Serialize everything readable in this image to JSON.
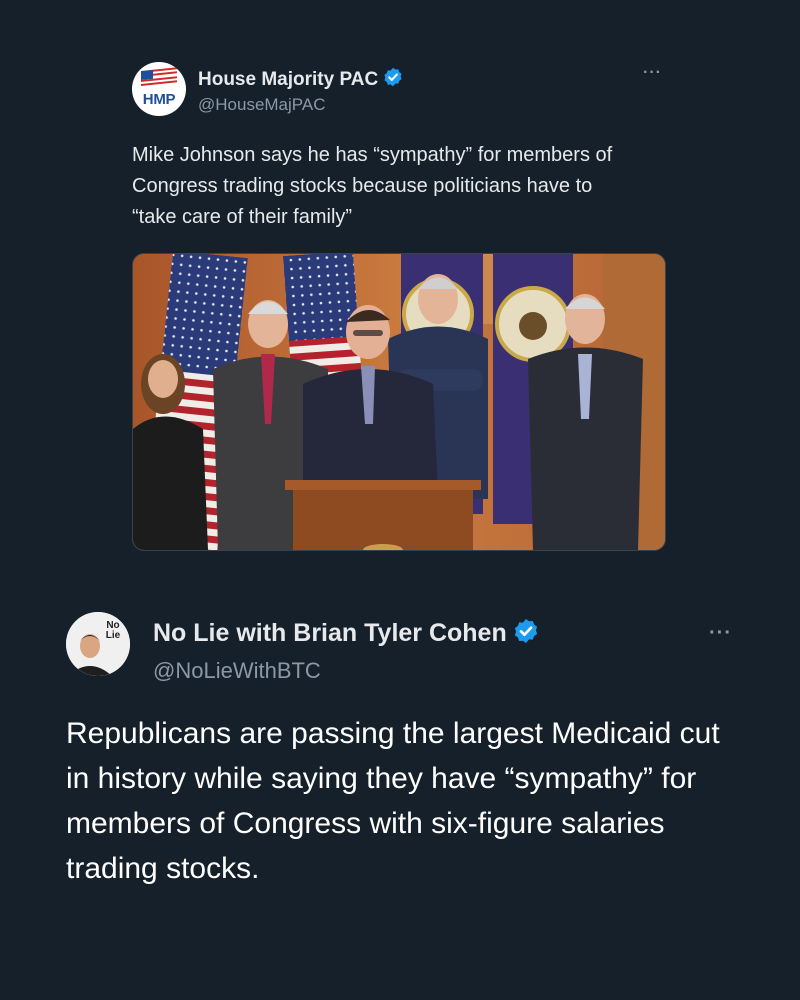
{
  "quoted_tweet": {
    "avatar_text": "HMP",
    "display_name": "House Majority PAC",
    "handle": "@HouseMajPAC",
    "more": "···",
    "text": "Mike Johnson says he has “sympathy” for members of Congress trading stocks because politicians have to “take care of their family”",
    "media": {
      "flags": [
        "us-flag",
        "us-flag",
        "house-flag",
        "house-flag"
      ]
    }
  },
  "main_tweet": {
    "avatar_text": "No Lie",
    "display_name": "No Lie with Brian Tyler Cohen",
    "handle": "@NoLieWithBTC",
    "more": "···",
    "text": "Republicans are passing the largest Medicaid cut in history while saying they have “sympathy” for members of Congress with six-figure salaries trading stocks."
  },
  "colors": {
    "background": "#15202b",
    "verified": "#1d9bf0",
    "secondary_text": "#8b98a5"
  }
}
